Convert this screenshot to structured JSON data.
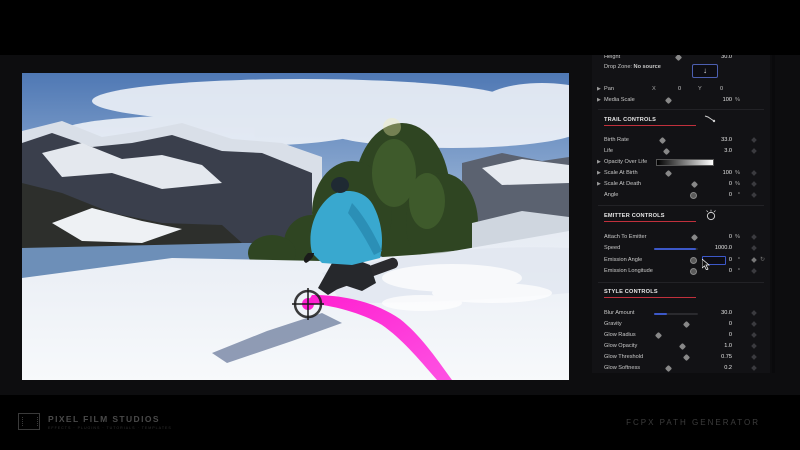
{
  "inspector": {
    "height_row": {
      "label": "Height",
      "value": "30.0"
    },
    "drop_zone": {
      "label": "Drop Zone:",
      "value": "No source",
      "button_glyph": "↓"
    },
    "pan": {
      "label": "Pan",
      "x_label": "X",
      "x_value": "0",
      "y_label": "Y",
      "y_value": "0"
    },
    "media_scale": {
      "label": "Media Scale",
      "value": "100",
      "unit": "%"
    },
    "trail_controls": {
      "title": "TRAIL CONTROLS",
      "birth_rate": {
        "label": "Birth Rate",
        "value": "33.0"
      },
      "life": {
        "label": "Life",
        "value": "3.0"
      },
      "opacity_over_life": {
        "label": "Opacity Over Life"
      },
      "scale_at_birth": {
        "label": "Scale At Birth",
        "value": "100",
        "unit": "%"
      },
      "scale_at_death": {
        "label": "Scale At Death",
        "value": "0",
        "unit": "%"
      },
      "angle": {
        "label": "Angle",
        "value": "0",
        "unit": "°"
      }
    },
    "emitter_controls": {
      "title": "EMITTER CONTROLS",
      "attach_to_emitter": {
        "label": "Attach To Emitter",
        "value": "0",
        "unit": "%"
      },
      "speed": {
        "label": "Speed",
        "value": "1000.0",
        "level": 0.95
      },
      "emission_angle": {
        "label": "Emission Angle",
        "value": "0",
        "unit": "°"
      },
      "emission_longitude": {
        "label": "Emission Longitude",
        "value": "0",
        "unit": "°"
      }
    },
    "style_controls": {
      "title": "STYLE CONTROLS",
      "blur_amount": {
        "label": "Blur Amount",
        "value": "30.0",
        "level": 0.3
      },
      "gravity": {
        "label": "Gravity",
        "value": "0"
      },
      "glow_radius": {
        "label": "Glow Radius",
        "value": "0"
      },
      "glow_opacity": {
        "label": "Glow Opacity",
        "value": "1.0"
      },
      "glow_threshold": {
        "label": "Glow Threshold",
        "value": "0.75"
      },
      "glow_softness": {
        "label": "Glow Softness",
        "value": "0.2"
      }
    }
  },
  "footer": {
    "brand_name": "PIXEL FILM STUDIOS",
    "brand_tagline": "EFFECTS · PLUGINS · TUTORIALS · TEMPLATES",
    "product_name": "FCPX PATH GENERATOR"
  },
  "colors": {
    "accent_blue": "#3c58c8",
    "section_underline": "#c0303c",
    "trail_magenta": "#ff1fd0"
  }
}
